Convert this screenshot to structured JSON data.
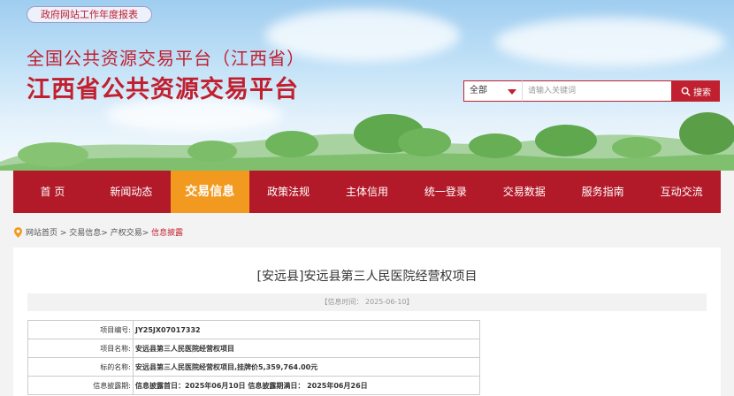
{
  "header": {
    "report_link": "政府网站工作年度报表",
    "title_line1": "全国公共资源交易平台（江西省）",
    "title_line2": "江西省公共资源交易平台"
  },
  "search": {
    "scope_selected": "全部",
    "placeholder": "请输入关键词",
    "button_label": "搜索"
  },
  "nav": {
    "items": [
      "首 页",
      "新闻动态",
      "交易信息",
      "政策法规",
      "主体信用",
      "统一登录",
      "交易数据",
      "服务指南",
      "互动交流"
    ],
    "active_index": 2
  },
  "breadcrumb": {
    "items": [
      "网站首页",
      "交易信息",
      "产权交易"
    ],
    "current": "信息披露"
  },
  "article": {
    "title": "[安远县]安远县第三人民医院经营权项目",
    "date_text": "【信息时间： 2025-06-10】",
    "rows": [
      {
        "label": "项目编号:",
        "value": "JY25JX07017332"
      },
      {
        "label": "项目名称:",
        "value": "安远县第三人民医院经营权项目"
      },
      {
        "label": "标的名称:",
        "value": "安远县第三人民医院经营权项目,挂牌价5,359,764.00元"
      },
      {
        "label": "信息披露期:",
        "value": "信息披露首日：2025年06月10日  信息披露期满日：  2025年06月26日"
      }
    ]
  },
  "colors": {
    "brand_red": "#b31a29",
    "active_orange": "#f29a20"
  }
}
